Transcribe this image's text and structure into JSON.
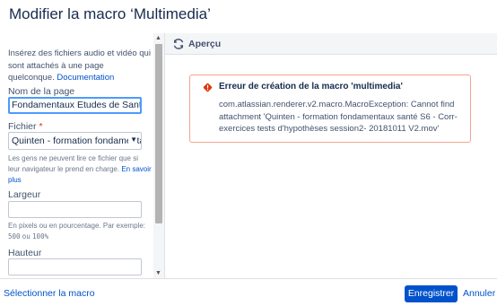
{
  "dialog": {
    "title": "Modifier la macro ‘Multimedia’"
  },
  "left": {
    "intro_text": "Insérez des fichiers audio et vidéo qui sont attachés à une page quelconque.",
    "intro_link": "Documentation",
    "page_name": {
      "label": "Nom de la page",
      "value": "Fondamentaux Etudes de Santé"
    },
    "file": {
      "label": "Fichier",
      "required_mark": "*",
      "value": "Quinten - formation fondamentaux",
      "help_text": "Les gens ne peuvent lire ce fichier que si leur navigateur le prend en charge.",
      "help_link": "En savoir plus"
    },
    "width": {
      "label": "Largeur",
      "value": "",
      "help_text": "En pixels ou en pourcentage. Par exemple:",
      "example_1": "500",
      "ou": "ou",
      "example_2": "100%"
    },
    "height": {
      "label": "Hauteur",
      "value": ""
    }
  },
  "preview": {
    "title": "Aperçu",
    "error_title": "Erreur de création de la macro 'multimedia'",
    "error_message": "com.atlassian.renderer.v2.macro.MacroException: Cannot find attachment 'Quinten - formation fondamentaux santé S6 - Corr- exercices tests d'hypothèses session2- 20181011 V2.mov'"
  },
  "footer": {
    "select_macro": "Sélectionner la macro",
    "save": "Enregistrer",
    "cancel": "Annuler"
  },
  "colors": {
    "primary": "#0052cc",
    "error_border": "#f2a48f",
    "error_icon": "#de350b",
    "focus": "#4c9aff"
  },
  "icons": {
    "refresh": "refresh-icon",
    "error": "error-icon",
    "dropdown": "chevron-down-icon"
  }
}
